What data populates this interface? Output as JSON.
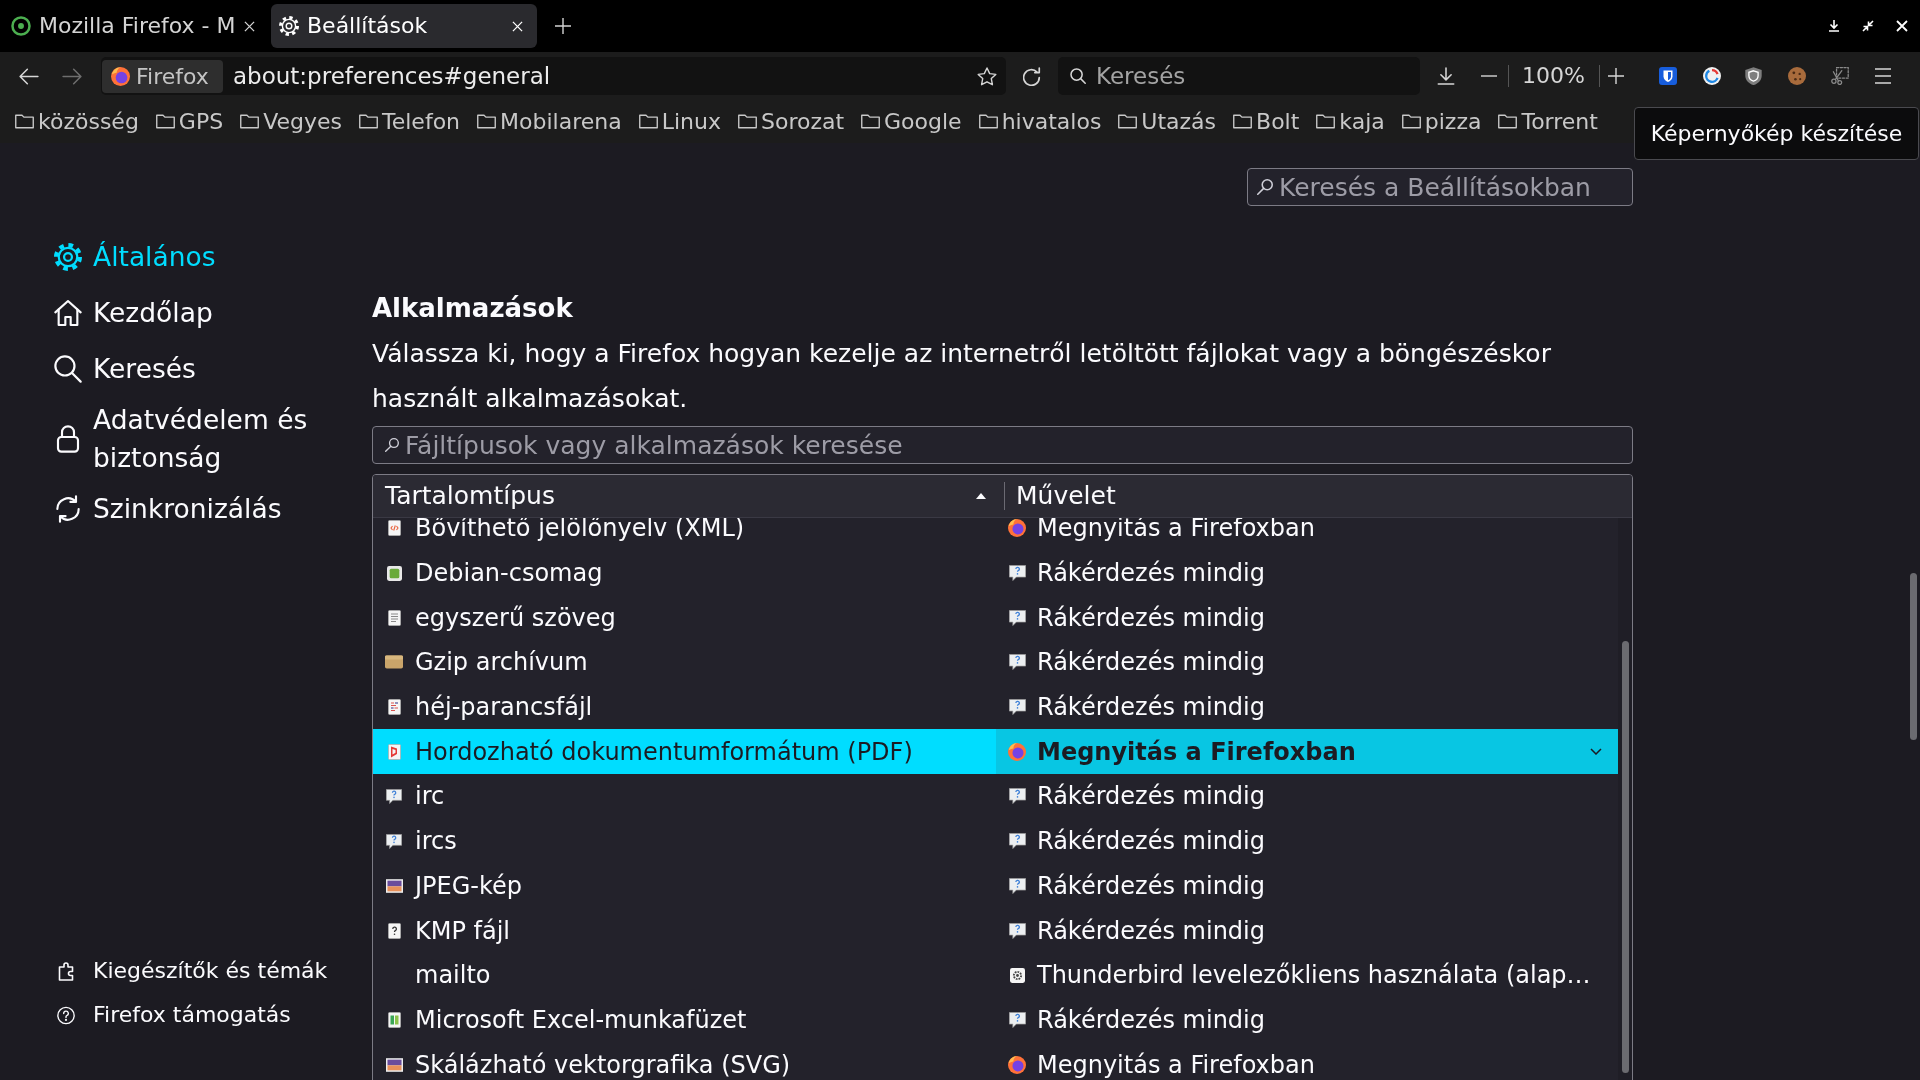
{
  "tabs": [
    {
      "kind": "web",
      "title": "Mozilla Firefox - M",
      "selected": false
    },
    {
      "kind": "settings",
      "title": "Beállítások",
      "selected": true
    }
  ],
  "nav_bar": {
    "back": {
      "disabled": false
    },
    "forward": {
      "disabled": true
    },
    "identity": "Firefox",
    "url": "about:preferences#general",
    "search": {
      "placeholder": "Keresés"
    },
    "zoom": "100%"
  },
  "bookmarks": [
    "közösség",
    "GPS",
    "Vegyes",
    "Telefon",
    "Mobilarena",
    "Linux",
    "Sorozat",
    "Google",
    "hivatalos",
    "Utazás",
    "Bolt",
    "kaja",
    "pizza",
    "Torrent"
  ],
  "tooltip": "Képernyőkép készítése",
  "settings_search": {
    "placeholder": "Keresés a Beállításokban"
  },
  "sidebar": {
    "items": [
      {
        "kind": "general",
        "label": "Általános",
        "selected": true
      },
      {
        "kind": "home",
        "label": "Kezdőlap",
        "selected": false
      },
      {
        "kind": "search",
        "label": "Keresés",
        "selected": false
      },
      {
        "kind": "privacy",
        "label": "Adatvédelem és biztonság",
        "selected": false
      },
      {
        "kind": "sync",
        "label": "Szinkronizálás",
        "selected": false
      }
    ],
    "footer_links": [
      {
        "kind": "addons",
        "label": "Kiegészítők és témák"
      },
      {
        "kind": "support",
        "label": "Firefox támogatás"
      }
    ]
  },
  "applications": {
    "title": "Alkalmazások",
    "description": "Válassza ki, hogy a Firefox hogyan kezelje az internetről letöltött fájlokat vagy a böngészéskor használt alkalmazásokat.",
    "filter": {
      "placeholder": "Fájltípusok vagy alkalmazások keresése"
    },
    "table": {
      "columns": [
        {
          "label": "Tartalomtípus",
          "sorted": true
        },
        {
          "label": "Művelet",
          "sorted": false
        }
      ],
      "rows": [
        {
          "type": {
            "kind": "xml",
            "label": "Bővíthető jelölőnyelv (XML)"
          },
          "action": {
            "kind": "firefox",
            "label": "Megnyitás a Firefoxban"
          },
          "selected": false
        },
        {
          "type": {
            "kind": "package",
            "label": "Debian-csomag"
          },
          "action": {
            "kind": "ask",
            "label": "Rákérdezés mindig"
          },
          "selected": false
        },
        {
          "type": {
            "kind": "text",
            "label": "egyszerű szöveg"
          },
          "action": {
            "kind": "ask",
            "label": "Rákérdezés mindig"
          },
          "selected": false
        },
        {
          "type": {
            "kind": "archive",
            "label": "Gzip archívum"
          },
          "action": {
            "kind": "ask",
            "label": "Rákérdezés mindig"
          },
          "selected": false
        },
        {
          "type": {
            "kind": "script",
            "label": "héj-parancsfájl"
          },
          "action": {
            "kind": "ask",
            "label": "Rákérdezés mindig"
          },
          "selected": false
        },
        {
          "type": {
            "kind": "pdf",
            "label": "Hordozható dokumentumformátum (PDF)"
          },
          "action": {
            "kind": "firefox",
            "label": "Megnyitás a Firefoxban"
          },
          "selected": true
        },
        {
          "type": {
            "kind": "chat",
            "label": "irc"
          },
          "action": {
            "kind": "ask",
            "label": "Rákérdezés mindig"
          },
          "selected": false
        },
        {
          "type": {
            "kind": "chat",
            "label": "ircs"
          },
          "action": {
            "kind": "ask",
            "label": "Rákérdezés mindig"
          },
          "selected": false
        },
        {
          "type": {
            "kind": "image",
            "label": "JPEG-kép"
          },
          "action": {
            "kind": "ask",
            "label": "Rákérdezés mindig"
          },
          "selected": false
        },
        {
          "type": {
            "kind": "unknown",
            "label": "KMP fájl"
          },
          "action": {
            "kind": "ask",
            "label": "Rákérdezés mindig"
          },
          "selected": false
        },
        {
          "type": {
            "kind": "none",
            "label": "mailto"
          },
          "action": {
            "kind": "app",
            "label": "Thunderbird levelezőkliens használata (alap…"
          },
          "selected": false
        },
        {
          "type": {
            "kind": "spreadsheet",
            "label": "Microsoft Excel-munkafüzet"
          },
          "action": {
            "kind": "ask",
            "label": "Rákérdezés mindig"
          },
          "selected": false
        },
        {
          "type": {
            "kind": "image",
            "label": "Skálázható vektorgrafika (SVG)"
          },
          "action": {
            "kind": "firefox",
            "label": "Megnyitás a Firefoxban"
          },
          "selected": false
        }
      ]
    }
  }
}
